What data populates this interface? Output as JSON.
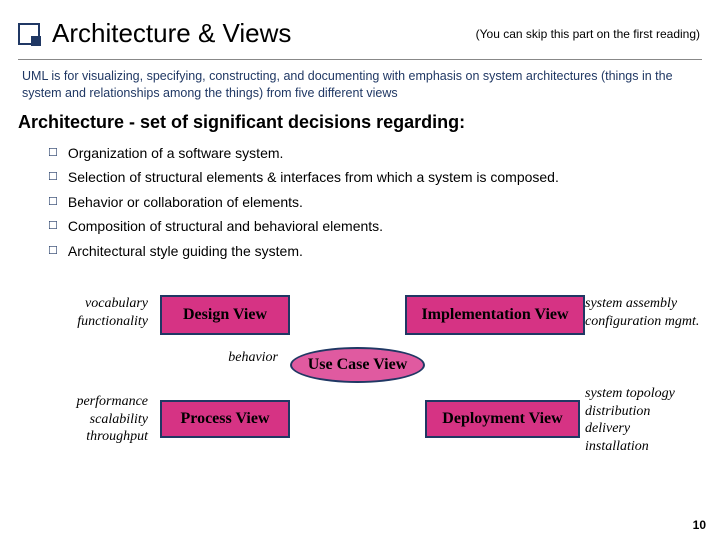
{
  "title": "Architecture & Views",
  "skip_note": "(You can skip this part on the first reading)",
  "uml_desc": "UML is for visualizing, specifying, constructing, and documenting with emphasis on system architectures (things in the system and relationships among the things)  from five different views",
  "arch_heading": "Architecture - set of significant decisions regarding:",
  "bullets": {
    "b0": "Organization of a software system.",
    "b1": "Selection of structural elements & interfaces from which a system is composed.",
    "b2": "Behavior or collaboration of elements.",
    "b3": "Composition of structural and behavioral elements.",
    "b4": "Architectural style guiding the system."
  },
  "views": {
    "design": "Design View",
    "impl": "Implementation View",
    "usecase": "Use Case View",
    "process": "Process View",
    "deploy": "Deployment View"
  },
  "labels": {
    "left_top": "vocabulary\nfunctionality",
    "right_top": "system assembly\nconfiguration mgmt.",
    "behavior": "behavior",
    "left_bot": "performance\nscalability\nthroughput",
    "right_bot": "system topology\ndistribution\ndelivery\ninstallation"
  },
  "page_number": "10"
}
